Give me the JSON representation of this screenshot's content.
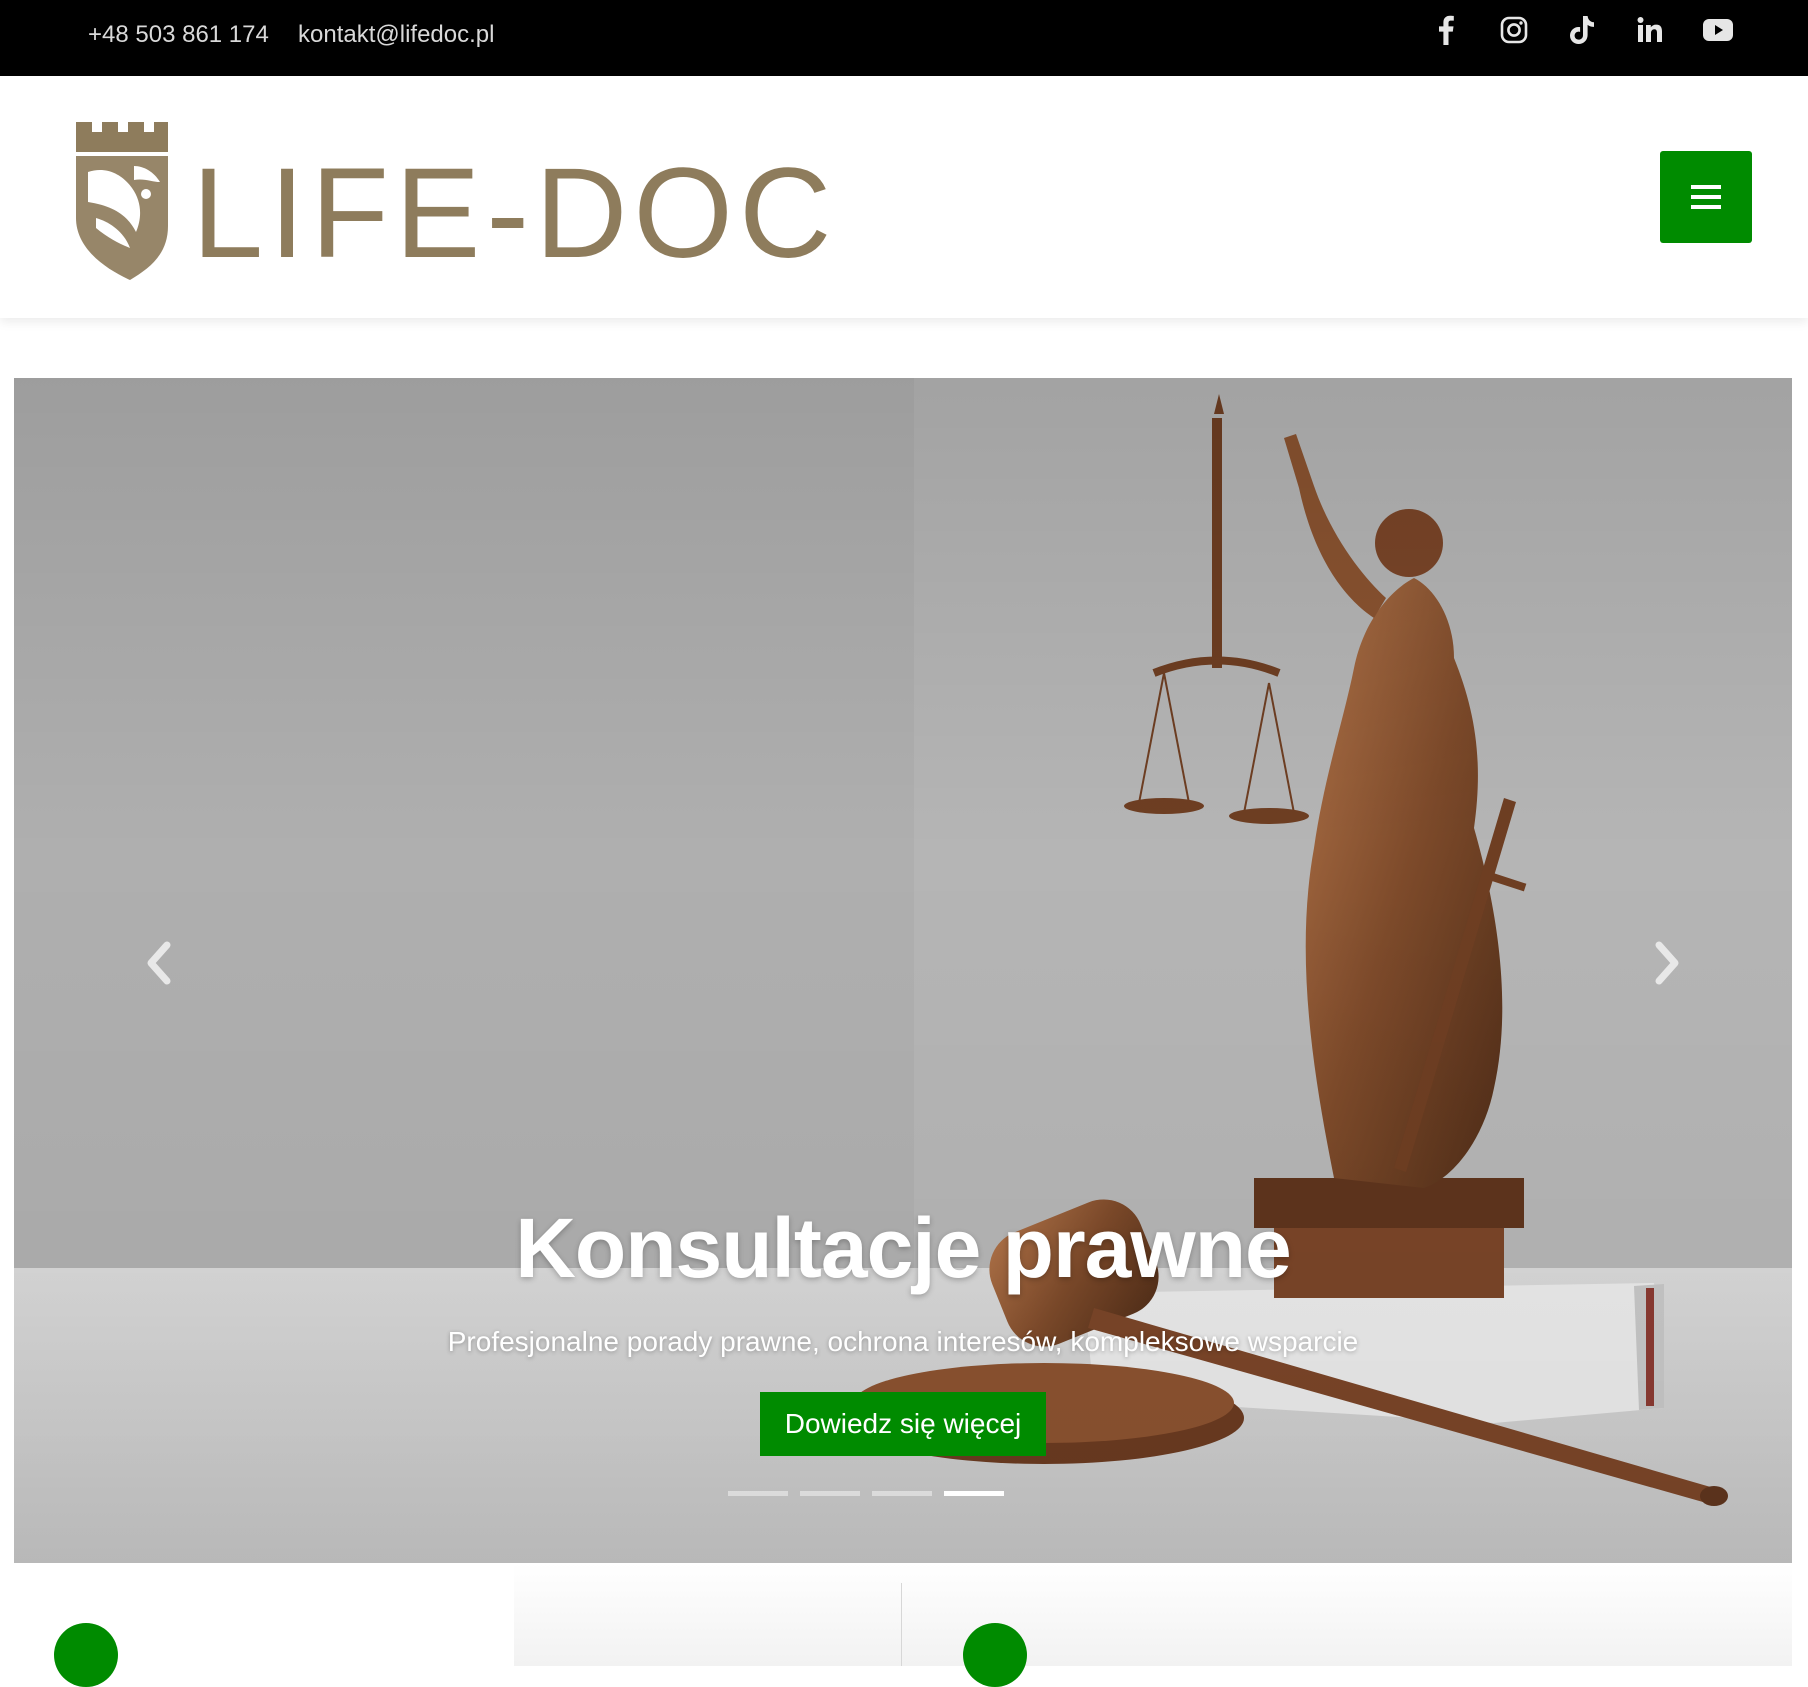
{
  "topbar": {
    "phone": "+48 503 861 174",
    "email": "kontakt@lifedoc.pl",
    "social": [
      "facebook-icon",
      "instagram-icon",
      "tiktok-icon",
      "linkedin-icon",
      "youtube-icon"
    ]
  },
  "header": {
    "logo_text": "LIFE-DOC",
    "logo_color": "#8e7c5c",
    "menu_icon": "hamburger-icon"
  },
  "hero": {
    "title": "Konsultacje prawne",
    "subtitle": "Profesjonalne porady prawne, ochrona interesów, kompleksowe wsparcie",
    "cta_label": "Dowiedz się więcej",
    "slides_total": 4,
    "active_slide": 4,
    "prev_icon": "chevron-left-icon",
    "next_icon": "chevron-right-icon"
  },
  "colors": {
    "accent": "#008b00",
    "topbar_bg": "#000000"
  }
}
